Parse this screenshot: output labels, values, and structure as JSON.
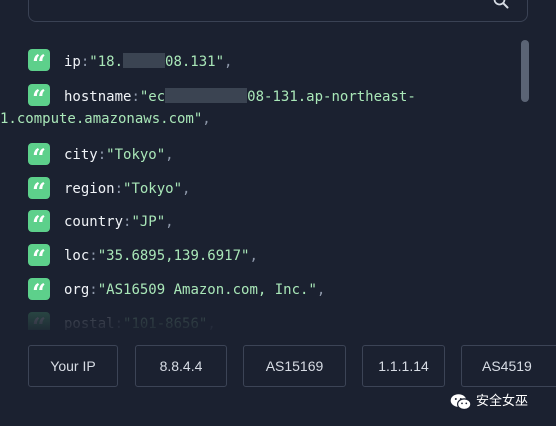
{
  "json_fields": [
    {
      "key": "ip",
      "value_prefix": "\"18.",
      "value_suffix": "08.131\"",
      "comma": ","
    },
    {
      "key": "hostname",
      "value_prefix": "\"ec",
      "value_suffix": "08-131.ap-northeast-",
      "value_wrap": "1.compute.amazonaws.com\"",
      "comma": ","
    },
    {
      "key": "city",
      "value": "\"Tokyo\"",
      "comma": ","
    },
    {
      "key": "region",
      "value": "\"Tokyo\"",
      "comma": ","
    },
    {
      "key": "country",
      "value": "\"JP\"",
      "comma": ","
    },
    {
      "key": "loc",
      "value": "\"35.6895,139.6917\"",
      "comma": ","
    },
    {
      "key": "org",
      "value": "\"AS16509 Amazon.com, Inc.\"",
      "comma": ","
    },
    {
      "key": "postal",
      "value": "\"101-8656\"",
      "comma": ","
    }
  ],
  "colon": ":",
  "quote_glyph": "“",
  "quick_lookups": [
    "Your IP",
    "8.8.4.4",
    "AS15169",
    "1.1.1.14",
    "AS4519"
  ],
  "watermark": {
    "text": "安全女巫",
    "icon": "wechat-icon"
  },
  "icons": {
    "search": "search-icon",
    "quote": "quote-icon"
  },
  "colors": {
    "background": "#1b2130",
    "badge": "#5dd08b",
    "value": "#a9e7b8",
    "key": "#f0f3f7",
    "border": "#3c4456"
  }
}
